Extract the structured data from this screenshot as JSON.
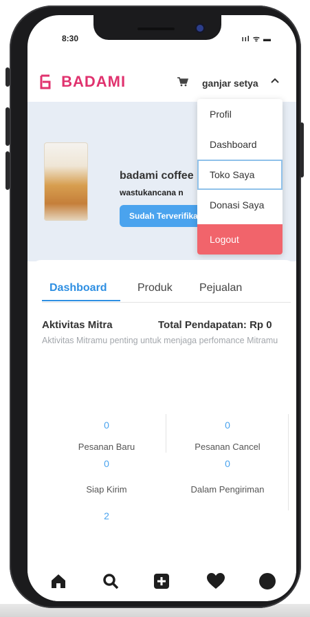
{
  "status": {
    "time": "8:30",
    "icons": "ııl ᯤ ▬"
  },
  "header": {
    "logo": "BADAMI",
    "user_name": "ganjar setya",
    "caret": "^"
  },
  "shop": {
    "name": "badami coffee",
    "address": "wastukancana n",
    "verified_label": "Sudah Terverifika"
  },
  "dropdown": {
    "items": [
      {
        "label": "Profil"
      },
      {
        "label": "Dashboard"
      },
      {
        "label": "Toko Saya"
      },
      {
        "label": "Donasi Saya"
      },
      {
        "label": "Logout"
      }
    ]
  },
  "tabs": [
    {
      "label": "Dashboard"
    },
    {
      "label": "Produk"
    },
    {
      "label": "Pejualan"
    }
  ],
  "dashboard": {
    "title": "Aktivitas Mitra",
    "total": "Total Pendapatan: Rp 0",
    "description": "Aktivitas Mitramu penting untuk menjaga perfomance Mitramu",
    "stats": [
      {
        "value": "0",
        "label": "Pesanan Baru"
      },
      {
        "value": "0",
        "label": "Pesanan Cancel"
      },
      {
        "value": "0",
        "label": "Siap Kirim"
      },
      {
        "value": "0",
        "label": "Dalam Pengiriman"
      },
      {
        "value": "2",
        "label": ""
      }
    ]
  },
  "bottom_nav": [
    {
      "icon": "home-icon"
    },
    {
      "icon": "search-icon"
    },
    {
      "icon": "add-icon"
    },
    {
      "icon": "heart-icon"
    },
    {
      "icon": "profile-icon"
    }
  ],
  "colors": {
    "accent": "#2e8fe2",
    "brand": "#e0326e",
    "logout": "#f1646b",
    "verified": "#4aa3ee"
  }
}
